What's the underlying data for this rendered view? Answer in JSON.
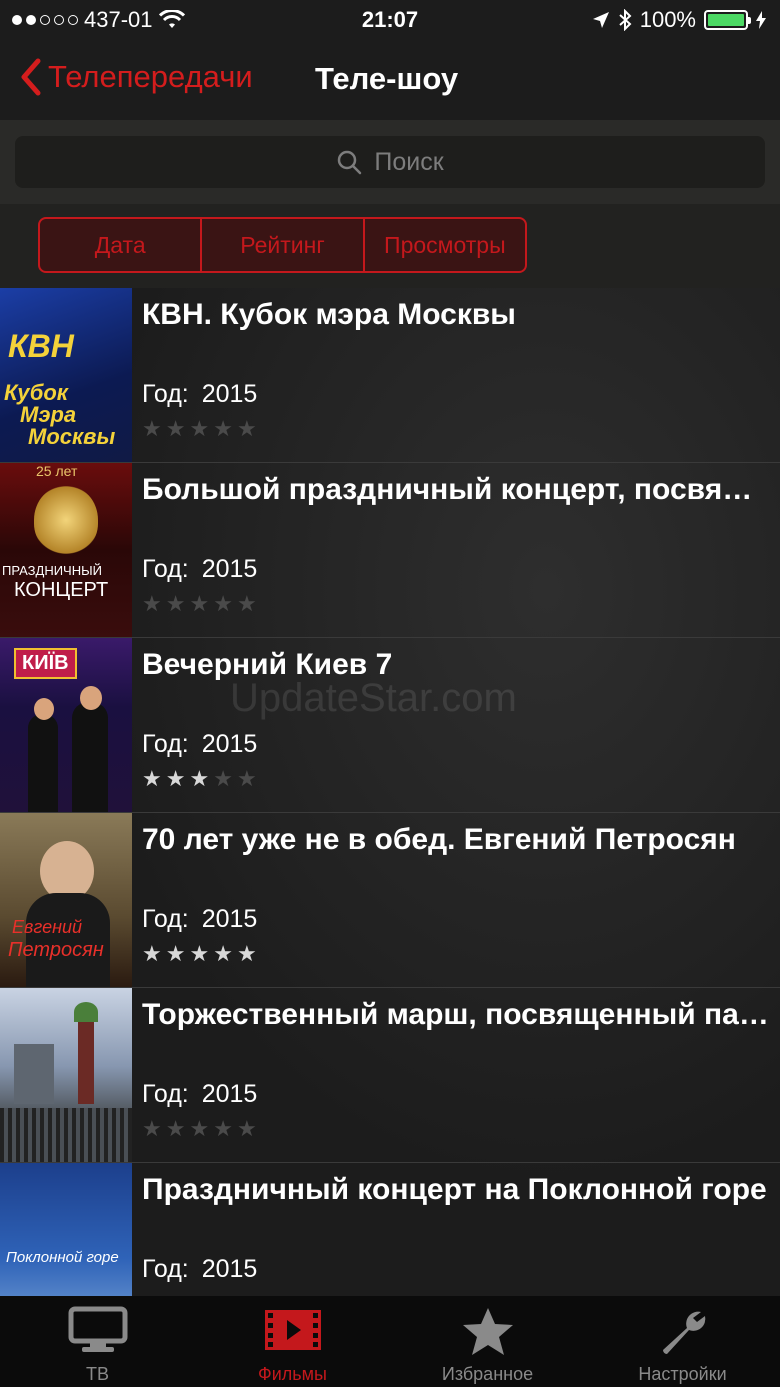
{
  "status_bar": {
    "carrier": "437-01",
    "time": "21:07",
    "battery": "100%",
    "signal_bars_filled": 2,
    "signal_bars_total": 5
  },
  "nav": {
    "back_label": "Телепередачи",
    "title": "Теле-шоу"
  },
  "search": {
    "placeholder": "Поиск"
  },
  "segments": [
    "Дата",
    "Рейтинг",
    "Просмотры"
  ],
  "items": [
    {
      "title": "КВН. Кубок мэра Москвы",
      "year_label": "Год:",
      "year": "2015",
      "rating": 0
    },
    {
      "title": "Большой праздничный концерт, посвященный Дню работника органов внутренних дел",
      "year_label": "Год:",
      "year": "2015",
      "rating": 0
    },
    {
      "title": "Вечерний Киев 7",
      "year_label": "Год:",
      "year": "2015",
      "rating": 3
    },
    {
      "title": "70 лет уже не в обед. Евгений Петросян",
      "year_label": "Год:",
      "year": "2015",
      "rating": 5
    },
    {
      "title": "Торжественный марш, посвященный параду",
      "year_label": "Год:",
      "year": "2015",
      "rating": 0
    },
    {
      "title": "Праздничный концерт на Поклонной горе",
      "year_label": "Год:",
      "year": "2015",
      "rating": 0
    }
  ],
  "thumb_text": {
    "t1a": "КВН",
    "t1b": "Кубок",
    "t1c": "Мэра",
    "t1d": "Москвы",
    "t2a": "25 лет",
    "t2b": "ПРАЗДНИЧНЫЙ",
    "t2c": "КОНЦЕРТ",
    "t3a": "КИЇВ",
    "t4a": "Евгений",
    "t4b": "Петросян",
    "t6a": "Поклонной горе"
  },
  "watermark": "UpdateStar.com",
  "tabs": [
    {
      "label": "ТВ",
      "icon": "tv-icon",
      "active": false
    },
    {
      "label": "Фильмы",
      "icon": "film-icon",
      "active": true
    },
    {
      "label": "Избранное",
      "icon": "star-icon",
      "active": false
    },
    {
      "label": "Настройки",
      "icon": "wrench-icon",
      "active": false
    }
  ],
  "colors": {
    "accent": "#c4181c",
    "background": "#1b1b1b",
    "battery": "#4cd964"
  }
}
